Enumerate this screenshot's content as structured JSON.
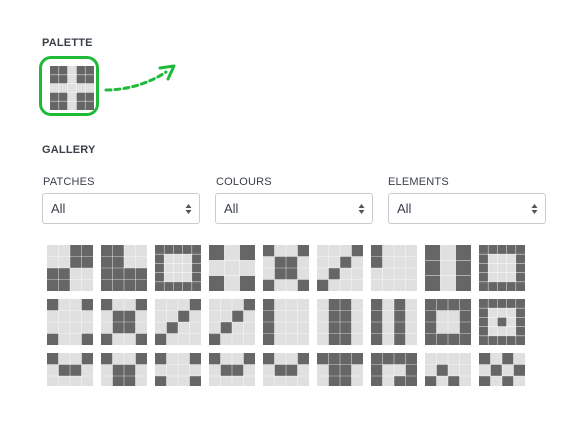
{
  "palette": {
    "title": "PALETTE",
    "pattern": [
      [
        1,
        1,
        0,
        1,
        1
      ],
      [
        1,
        1,
        0,
        1,
        1
      ],
      [
        0,
        0,
        0,
        0,
        0
      ],
      [
        1,
        1,
        0,
        1,
        1
      ],
      [
        1,
        1,
        0,
        1,
        1
      ]
    ]
  },
  "gallery": {
    "title": "GALLERY",
    "filters": [
      {
        "label": "PATCHES",
        "value": "All"
      },
      {
        "label": "COLOURS",
        "value": "All"
      },
      {
        "label": "ELEMENTS",
        "value": "All"
      }
    ],
    "colors": {
      "dark": "#666666",
      "light": "#e0e0e0",
      "accent": "#1fba3a"
    },
    "tiles": [
      [
        [
          [
            0,
            0,
            1,
            1
          ],
          [
            0,
            0,
            1,
            1
          ],
          [
            1,
            1,
            0,
            0
          ],
          [
            1,
            1,
            0,
            0
          ]
        ],
        [
          [
            1,
            1,
            0,
            0
          ],
          [
            1,
            1,
            0,
            0
          ],
          [
            1,
            1,
            1,
            1
          ],
          [
            1,
            1,
            1,
            1
          ]
        ],
        [
          [
            1,
            1,
            1,
            1,
            1
          ],
          [
            1,
            0,
            0,
            0,
            1
          ],
          [
            1,
            0,
            0,
            0,
            1
          ],
          [
            1,
            0,
            0,
            0,
            1
          ],
          [
            1,
            1,
            1,
            1,
            1
          ]
        ],
        [
          [
            1,
            0,
            1
          ],
          [
            0,
            0,
            0
          ],
          [
            1,
            0,
            1
          ]
        ],
        [
          [
            1,
            0,
            0,
            1
          ],
          [
            0,
            1,
            1,
            0
          ],
          [
            0,
            1,
            1,
            0
          ],
          [
            1,
            0,
            0,
            1
          ]
        ],
        [
          [
            0,
            0,
            0,
            1
          ],
          [
            0,
            0,
            1,
            0
          ],
          [
            0,
            1,
            0,
            0
          ],
          [
            1,
            0,
            0,
            0
          ]
        ],
        [
          [
            1,
            0,
            0,
            0
          ],
          [
            1,
            0,
            0,
            0
          ],
          [
            0,
            0,
            0,
            0
          ],
          [
            0,
            0,
            0,
            0
          ]
        ],
        [
          [
            1,
            0,
            1
          ],
          [
            1,
            0,
            1
          ],
          [
            1,
            0,
            1
          ]
        ],
        [
          [
            1,
            1,
            1,
            1,
            1
          ],
          [
            1,
            0,
            0,
            0,
            1
          ],
          [
            1,
            0,
            0,
            0,
            1
          ],
          [
            1,
            0,
            0,
            0,
            1
          ],
          [
            1,
            1,
            1,
            1,
            1
          ]
        ]
      ],
      [
        [
          [
            1,
            0,
            0,
            1
          ],
          [
            0,
            0,
            0,
            0
          ],
          [
            0,
            0,
            0,
            0
          ],
          [
            1,
            0,
            0,
            1
          ]
        ],
        [
          [
            1,
            0,
            0,
            1
          ],
          [
            0,
            1,
            1,
            0
          ],
          [
            0,
            1,
            1,
            0
          ],
          [
            1,
            0,
            0,
            1
          ]
        ],
        [
          [
            0,
            0,
            0,
            1
          ],
          [
            0,
            0,
            1,
            0
          ],
          [
            0,
            1,
            0,
            0
          ],
          [
            1,
            0,
            0,
            0
          ]
        ],
        [
          [
            0,
            0,
            0,
            1
          ],
          [
            0,
            0,
            1,
            0
          ],
          [
            0,
            1,
            0,
            0
          ],
          [
            1,
            0,
            0,
            0
          ]
        ],
        [
          [
            1,
            0,
            0,
            0
          ],
          [
            1,
            0,
            0,
            0
          ],
          [
            1,
            0,
            0,
            0
          ],
          [
            1,
            0,
            0,
            0
          ]
        ],
        [
          [
            0,
            1,
            1,
            0
          ],
          [
            0,
            1,
            1,
            0
          ],
          [
            0,
            1,
            1,
            0
          ],
          [
            0,
            1,
            1,
            0
          ]
        ],
        [
          [
            1,
            0,
            1,
            0
          ],
          [
            1,
            0,
            1,
            0
          ],
          [
            1,
            0,
            1,
            0
          ],
          [
            1,
            0,
            1,
            0
          ]
        ],
        [
          [
            1,
            1,
            1,
            1
          ],
          [
            1,
            0,
            0,
            1
          ],
          [
            1,
            0,
            0,
            1
          ],
          [
            1,
            1,
            1,
            1
          ]
        ],
        [
          [
            1,
            1,
            1,
            1,
            1
          ],
          [
            1,
            0,
            0,
            0,
            1
          ],
          [
            1,
            0,
            1,
            0,
            1
          ],
          [
            1,
            0,
            0,
            0,
            1
          ],
          [
            1,
            1,
            1,
            1,
            1
          ]
        ]
      ],
      [
        [
          [
            1,
            0,
            0,
            1
          ],
          [
            0,
            1,
            1,
            0
          ],
          [
            0,
            0,
            0,
            0
          ],
          [
            1,
            0,
            0,
            1
          ]
        ],
        [
          [
            1,
            0,
            0,
            1
          ],
          [
            0,
            1,
            1,
            0
          ],
          [
            0,
            1,
            1,
            0
          ],
          [
            1,
            0,
            0,
            1
          ]
        ],
        [
          [
            1,
            0,
            0,
            1
          ],
          [
            0,
            0,
            0,
            0
          ],
          [
            1,
            0,
            0,
            1
          ],
          [
            0,
            0,
            0,
            0
          ]
        ],
        [
          [
            1,
            0,
            0,
            1
          ],
          [
            0,
            1,
            1,
            0
          ],
          [
            0,
            0,
            0,
            0
          ],
          [
            1,
            0,
            0,
            1
          ]
        ],
        [
          [
            1,
            0,
            0,
            1
          ],
          [
            0,
            1,
            1,
            0
          ],
          [
            0,
            0,
            0,
            0
          ],
          [
            0,
            1,
            1,
            0
          ]
        ],
        [
          [
            1,
            1,
            1,
            1
          ],
          [
            0,
            1,
            1,
            0
          ],
          [
            0,
            1,
            1,
            0
          ],
          [
            0,
            1,
            1,
            0
          ]
        ],
        [
          [
            1,
            1,
            1,
            1
          ],
          [
            1,
            0,
            0,
            1
          ],
          [
            1,
            0,
            1,
            1
          ],
          [
            1,
            1,
            1,
            1
          ]
        ],
        [
          [
            0,
            0,
            0,
            0
          ],
          [
            0,
            1,
            0,
            0
          ],
          [
            1,
            0,
            1,
            0
          ],
          [
            0,
            1,
            0,
            1
          ]
        ],
        [
          [
            1,
            0,
            1,
            0
          ],
          [
            0,
            1,
            0,
            1
          ],
          [
            1,
            0,
            1,
            0
          ],
          [
            0,
            1,
            0,
            1
          ]
        ]
      ]
    ]
  }
}
